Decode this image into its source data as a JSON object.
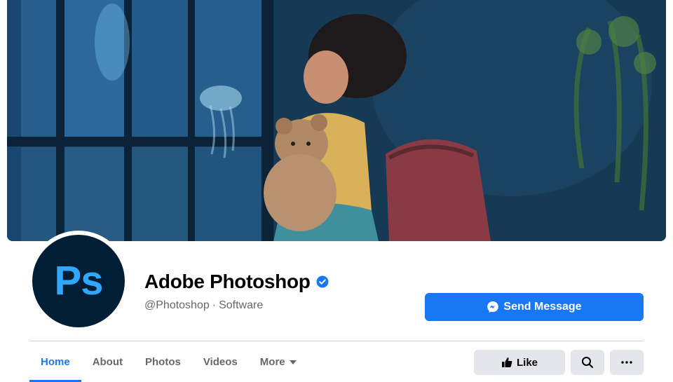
{
  "cover": {
    "description_icon": "cover-photo",
    "colors": {
      "water": "#183d5c",
      "chair": "#8a3a44",
      "bear": "#b08a66"
    }
  },
  "profile": {
    "avatar_logo_text": "Ps",
    "name": "Adobe Photoshop",
    "verified_icon": "verified-badge-icon",
    "handle": "@Photoshop",
    "separator": "·",
    "category": "Software"
  },
  "actions": {
    "send_message_label": "Send Message",
    "like_label": "Like",
    "search_icon": "search-icon",
    "more_icon": "ellipsis-icon"
  },
  "tabs": [
    {
      "label": "Home",
      "active": true
    },
    {
      "label": "About",
      "active": false
    },
    {
      "label": "Photos",
      "active": false
    },
    {
      "label": "Videos",
      "active": false
    },
    {
      "label": "More",
      "active": false
    }
  ],
  "colors": {
    "accent": "#1877f2",
    "text_primary": "#050505",
    "text_secondary": "#65676b",
    "button_gray": "#e4e6eb",
    "ps_logo_bg": "#001e36",
    "ps_logo_fg": "#31a8ff"
  }
}
